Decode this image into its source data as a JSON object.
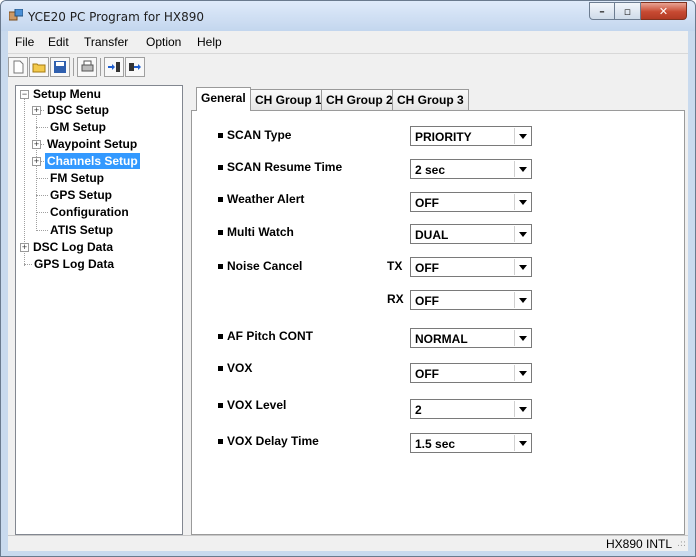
{
  "window": {
    "title": "YCE20 PC Program for HX890"
  },
  "menu": {
    "items": [
      "File",
      "Edit",
      "Transfer",
      "Option",
      "Help"
    ]
  },
  "toolbar": {
    "buttons": [
      "new-icon",
      "open-folder-icon",
      "save-icon",
      "print-icon",
      "read-from-radio-icon",
      "write-to-radio-icon"
    ]
  },
  "tree": {
    "root": "Setup Menu",
    "children": [
      "DSC Setup",
      "GM Setup",
      "Waypoint Setup",
      "Channels Setup",
      "FM Setup",
      "GPS Setup",
      "Configuration",
      "ATIS Setup"
    ],
    "selected": "Channels Setup",
    "dsc_log": "DSC Log Data",
    "gps_log": "GPS Log Data"
  },
  "tabs": [
    "General",
    "CH Group 1",
    "CH Group 2",
    "CH Group 3"
  ],
  "settings": {
    "scan_type": {
      "label": "SCAN Type",
      "value": "PRIORITY"
    },
    "scan_resume": {
      "label": "SCAN Resume Time",
      "value": "2 sec"
    },
    "weather_alert": {
      "label": "Weather Alert",
      "value": "OFF"
    },
    "multi_watch": {
      "label": "Multi Watch",
      "value": "DUAL"
    },
    "noise_cancel": {
      "label": "Noise Cancel",
      "tx_label": "TX",
      "tx_value": "OFF",
      "rx_label": "RX",
      "rx_value": "OFF"
    },
    "af_pitch": {
      "label": "AF Pitch CONT",
      "value": "NORMAL"
    },
    "vox": {
      "label": "VOX",
      "value": "OFF"
    },
    "vox_level": {
      "label": "VOX Level",
      "value": "2"
    },
    "vox_delay": {
      "label": "VOX Delay Time",
      "value": "1.5 sec"
    }
  },
  "status": {
    "model": "HX890 INTL"
  }
}
